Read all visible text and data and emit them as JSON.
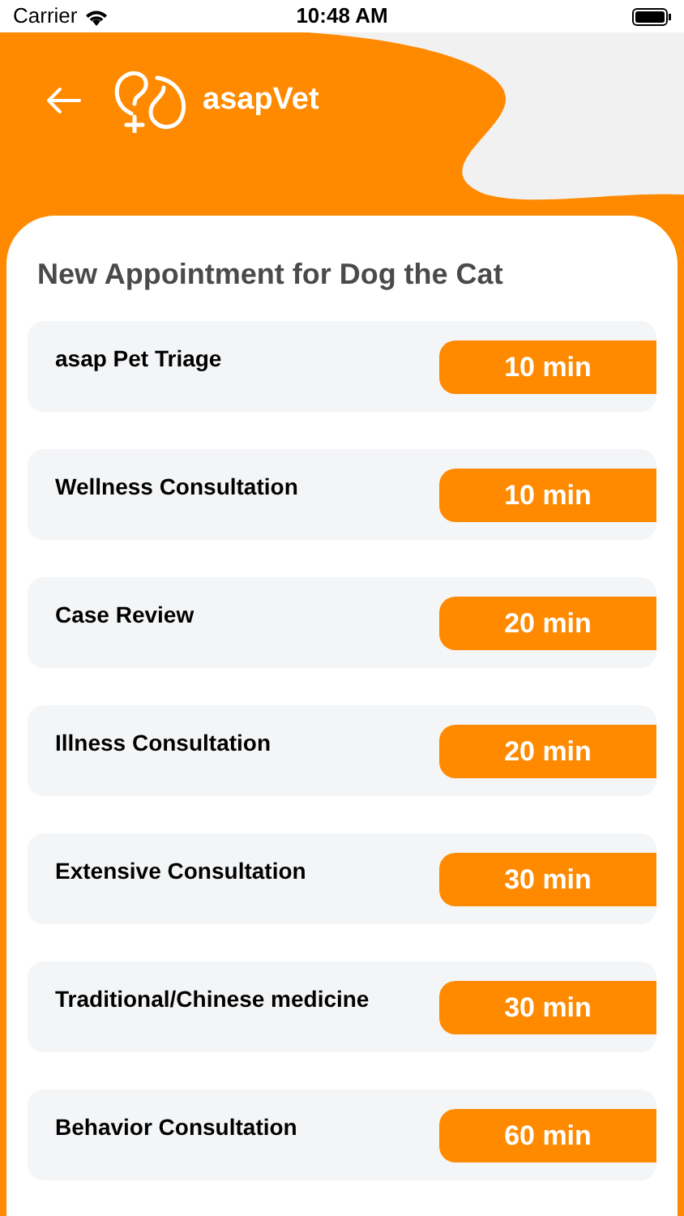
{
  "status_bar": {
    "carrier": "Carrier",
    "time": "10:48 AM"
  },
  "header": {
    "brand": "asapVet"
  },
  "title": "New Appointment for Dog the Cat",
  "services": [
    {
      "name": "asap Pet Triage",
      "duration": "10 min"
    },
    {
      "name": "Wellness Consultation",
      "duration": "10 min"
    },
    {
      "name": "Case Review",
      "duration": "20 min"
    },
    {
      "name": "Illness Consultation",
      "duration": "20 min"
    },
    {
      "name": "Extensive Consultation",
      "duration": "30 min"
    },
    {
      "name": "Traditional/Chinese medicine",
      "duration": "30 min"
    },
    {
      "name": "Behavior Consultation",
      "duration": "60 min"
    }
  ]
}
